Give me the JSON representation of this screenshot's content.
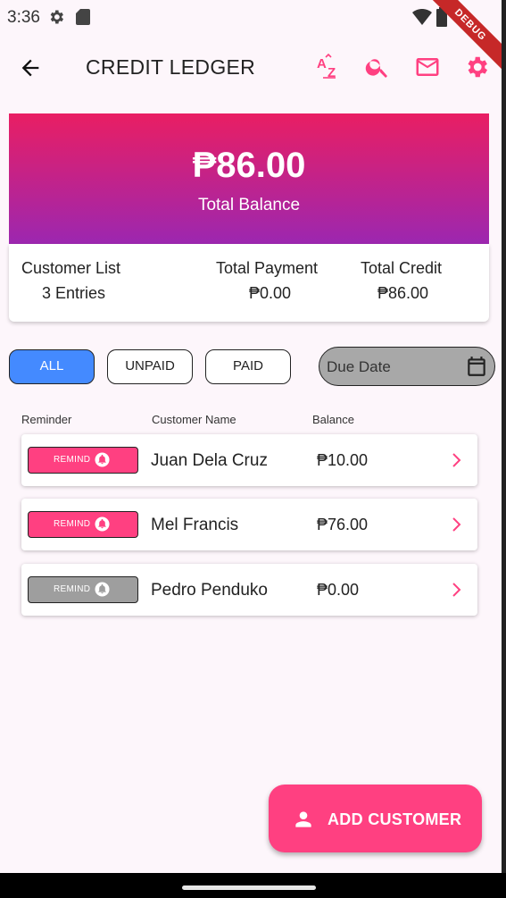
{
  "status_bar": {
    "time": "3:36"
  },
  "debug_banner": "DEBUG",
  "app_bar": {
    "title": "CREDIT LEDGER",
    "accent": "#ff4081"
  },
  "hero": {
    "total_balance": "₱86.00",
    "label": "Total Balance",
    "gradient": [
      "#e91e63",
      "#9c27b0"
    ]
  },
  "summary": {
    "customer_list_label": "Customer List",
    "customer_list_value": "3 Entries",
    "total_payment_label": "Total Payment",
    "total_payment_value": "₱0.00",
    "total_credit_label": "Total Credit",
    "total_credit_value": "₱86.00"
  },
  "filters": {
    "all": "ALL",
    "unpaid": "UNPAID",
    "paid": "PAID",
    "selected": "ALL",
    "due_date_placeholder": "Due Date"
  },
  "table_headers": {
    "reminder": "Reminder",
    "customer_name": "Customer Name",
    "balance": "Balance"
  },
  "customers": [
    {
      "remind_label": "REMIND",
      "name": "Juan Dela Cruz",
      "balance": "₱10.00",
      "remind_enabled": true
    },
    {
      "remind_label": "REMIND",
      "name": "Mel Francis",
      "balance": "₱76.00",
      "remind_enabled": true
    },
    {
      "remind_label": "REMIND",
      "name": "Pedro Penduko",
      "balance": "₱0.00",
      "remind_enabled": false
    }
  ],
  "fab": {
    "label": "ADD CUSTOMER"
  }
}
